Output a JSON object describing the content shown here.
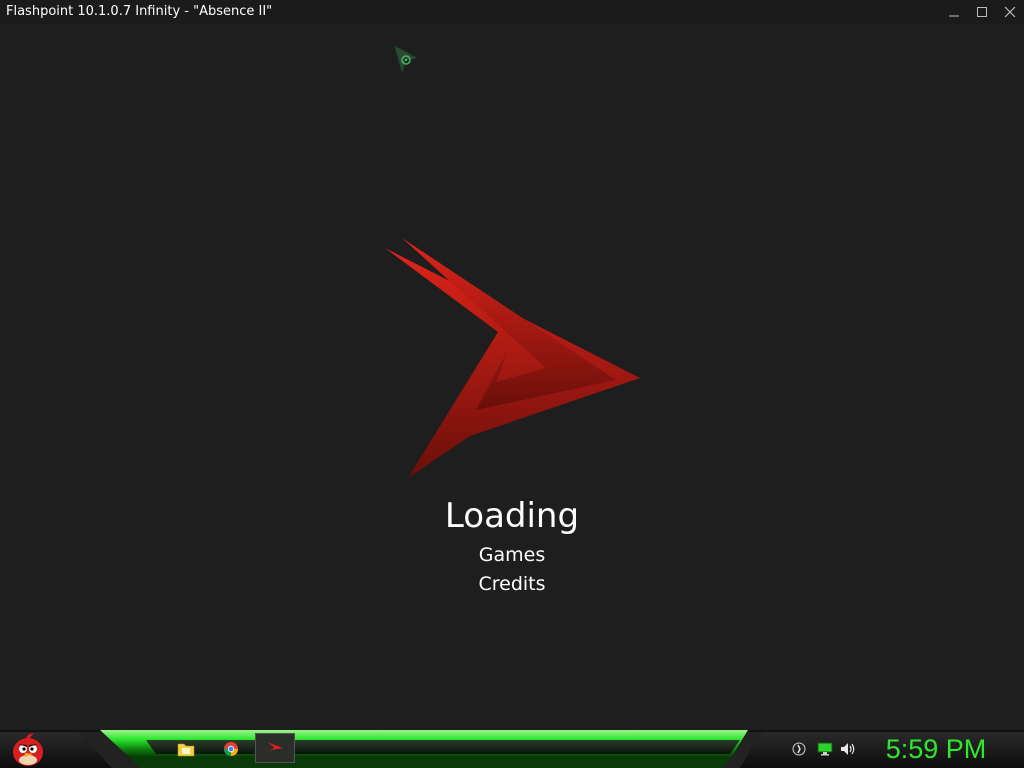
{
  "window": {
    "title": "Flashpoint 10.1.0.7 Infinity - \"Absence II\"",
    "controls": [
      "minimize-icon",
      "maximize-icon",
      "close-icon"
    ]
  },
  "main": {
    "loading_label": "Loading",
    "menu": [
      {
        "label": "Games"
      },
      {
        "label": "Credits"
      }
    ],
    "logo_colors": {
      "top": "#e0241a",
      "bottom": "#6a0f0a"
    }
  },
  "taskbar": {
    "accent_color": "#2ee82e",
    "pinned_apps": [
      "angry-birds-start-icon",
      "file-explorer-icon",
      "chrome-icon",
      "flashpoint-icon"
    ],
    "tray_icons": [
      "clock-app-icon",
      "network-icon",
      "volume-icon"
    ],
    "clock": "5:59 PM"
  },
  "cursor": "mouse-pointer-icon"
}
